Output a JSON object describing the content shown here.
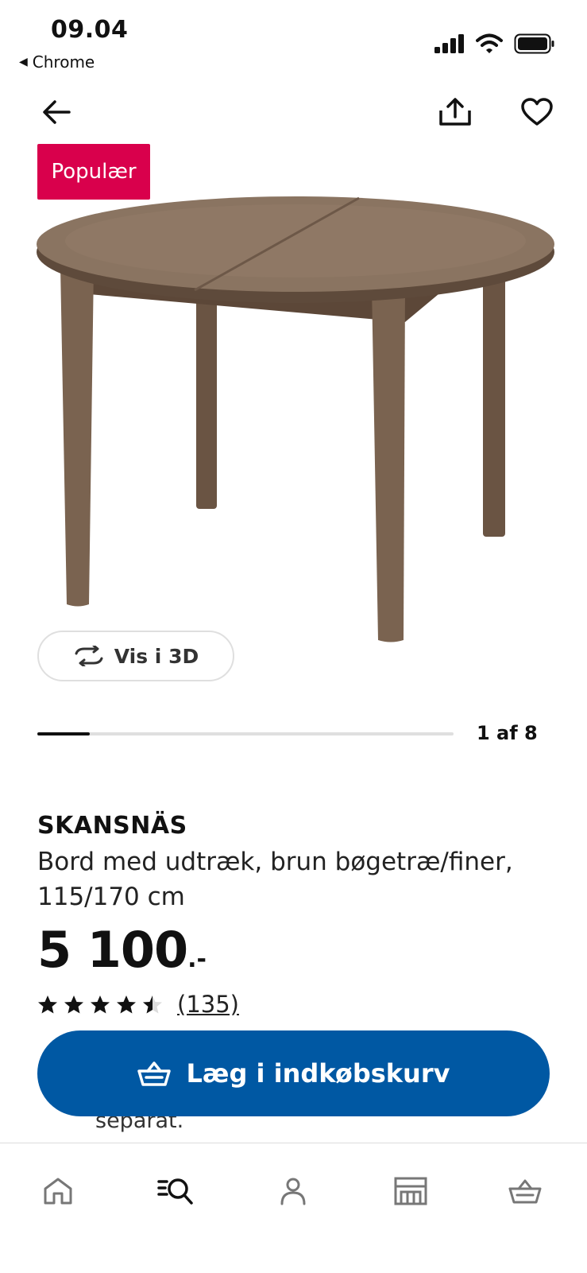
{
  "status_bar": {
    "time": "09.04",
    "back_app": "Chrome"
  },
  "header": {
    "back_icon": "arrow-left-icon",
    "share_icon": "share-icon",
    "favorite_icon": "heart-icon"
  },
  "product": {
    "badge": "Populær",
    "view_3d_label": "Vis i 3D",
    "image_position": {
      "current": 1,
      "total": 8,
      "label": "1 af 8"
    },
    "name": "SKANSNÄS",
    "description": "Bord med udtræk, brun bøgetræ/finer, 115/170 cm",
    "price_integer": "5 100",
    "price_decimals": ".-",
    "rating": 4.5,
    "rating_max": 5,
    "review_count": "(135)",
    "footer_peek_text": "separat."
  },
  "cart_button": {
    "label": "Læg i indkøbskurv",
    "icon": "basket-icon"
  },
  "bottom_nav": [
    {
      "id": "home",
      "icon": "home-icon",
      "active": false
    },
    {
      "id": "search",
      "icon": "search-icon",
      "active": true
    },
    {
      "id": "profile",
      "icon": "profile-icon",
      "active": false
    },
    {
      "id": "store",
      "icon": "store-icon",
      "active": false
    },
    {
      "id": "basket",
      "icon": "basket-icon",
      "active": false
    }
  ],
  "colors": {
    "badge": "#d9004c",
    "primary_button": "#0058a3",
    "table_wood": "#7a6552"
  }
}
